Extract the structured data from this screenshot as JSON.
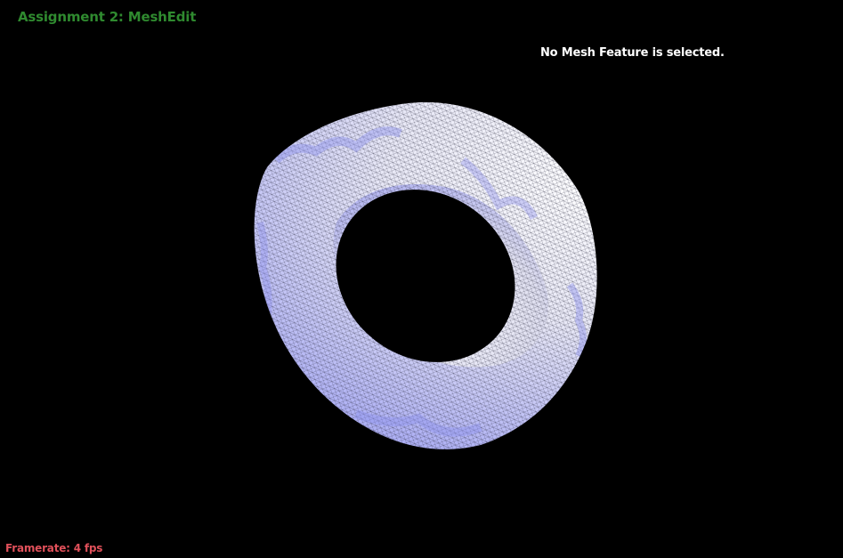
{
  "app": {
    "title": "Assignment 2: MeshEdit",
    "status_message": "No Mesh Feature is selected.",
    "framerate_text": "Framerate: 4 fps"
  },
  "colors": {
    "background": "#000000",
    "title": "#2f8a2f",
    "status": "#ffffff",
    "framerate": "#e0505a",
    "mesh_shade": "#9a9cf2",
    "mesh_highlight": "#ffffff",
    "wireframe": "#2a2a40"
  },
  "scene": {
    "object": "torus-mesh",
    "render_mode": "wireframe-over-shaded"
  }
}
